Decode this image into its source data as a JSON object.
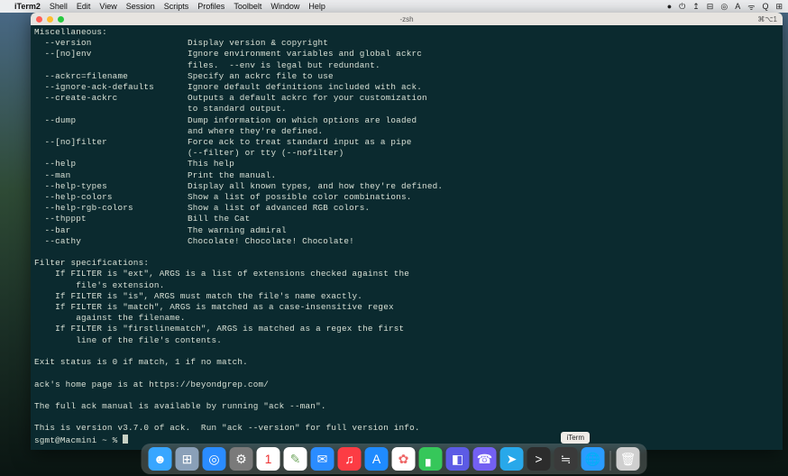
{
  "menubar": {
    "apple": "",
    "app": "iTerm2",
    "items": [
      "Shell",
      "Edit",
      "View",
      "Session",
      "Scripts",
      "Profiles",
      "Toolbelt",
      "Window",
      "Help"
    ],
    "status": [
      "●",
      "⏻",
      "↥",
      "⊟",
      "◎",
      "A",
      "ᯤ",
      "Q",
      "⊞"
    ],
    "right_text": ""
  },
  "window": {
    "title": "-zsh",
    "right_label": "⌘⌥1"
  },
  "term": {
    "section_header": "Miscellaneous:",
    "options": [
      {
        "flag": "  --version",
        "desc": "Display version & copyright"
      },
      {
        "flag": "  --[no]env",
        "desc": "Ignore environment variables and global ackrc"
      },
      {
        "flag": "",
        "desc": "files.  --env is legal but redundant."
      },
      {
        "flag": "  --ackrc=filename",
        "desc": "Specify an ackrc file to use"
      },
      {
        "flag": "  --ignore-ack-defaults",
        "desc": "Ignore default definitions included with ack."
      },
      {
        "flag": "  --create-ackrc",
        "desc": "Outputs a default ackrc for your customization"
      },
      {
        "flag": "",
        "desc": "to standard output."
      },
      {
        "flag": "  --dump",
        "desc": "Dump information on which options are loaded"
      },
      {
        "flag": "",
        "desc": "and where they're defined."
      },
      {
        "flag": "  --[no]filter",
        "desc": "Force ack to treat standard input as a pipe"
      },
      {
        "flag": "",
        "desc": "(--filter) or tty (--nofilter)"
      },
      {
        "flag": "  --help",
        "desc": "This help"
      },
      {
        "flag": "  --man",
        "desc": "Print the manual."
      },
      {
        "flag": "  --help-types",
        "desc": "Display all known types, and how they're defined."
      },
      {
        "flag": "  --help-colors",
        "desc": "Show a list of possible color combinations."
      },
      {
        "flag": "  --help-rgb-colors",
        "desc": "Show a list of advanced RGB colors."
      },
      {
        "flag": "  --thpppt",
        "desc": "Bill the Cat"
      },
      {
        "flag": "  --bar",
        "desc": "The warning admiral"
      },
      {
        "flag": "  --cathy",
        "desc": "Chocolate! Chocolate! Chocolate!"
      }
    ],
    "filterspec_header": "Filter specifications:",
    "filterspec_lines": [
      "    If FILTER is \"ext\", ARGS is a list of extensions checked against the",
      "        file's extension.",
      "    If FILTER is \"is\", ARGS must match the file's name exactly.",
      "    If FILTER is \"match\", ARGS is matched as a case-insensitive regex",
      "        against the filename.",
      "    If FILTER is \"firstlinematch\", ARGS is matched as a regex the first",
      "        line of the file's contents."
    ],
    "exit_status": "Exit status is 0 if match, 1 if no match.",
    "homepage": "ack's home page is at https://beyondgrep.com/",
    "manual_line": "The full ack manual is available by running \"ack --man\".",
    "version_line": "This is version v3.7.0 of ack.  Run \"ack --version\" for full version info.",
    "prompt": "sgmt@Macmini ~ % "
  },
  "dock": {
    "tooltip": "iTerm",
    "items": [
      {
        "name": "finder",
        "bg": "#38a6ff",
        "glyph": "☻"
      },
      {
        "name": "launchpad",
        "bg": "#8aa0b8",
        "glyph": "⊞"
      },
      {
        "name": "safari",
        "bg": "#2a8cff",
        "glyph": "◎"
      },
      {
        "name": "settings",
        "bg": "#7a7a7a",
        "glyph": "⚙"
      },
      {
        "name": "calendar",
        "bg": "#ffffff",
        "glyph": "1",
        "fg": "#e33"
      },
      {
        "name": "freeform",
        "bg": "#ffffff",
        "glyph": "✎",
        "fg": "#7a6"
      },
      {
        "name": "mail",
        "bg": "#2a8cff",
        "glyph": "✉"
      },
      {
        "name": "music",
        "bg": "#fc3c44",
        "glyph": "♫"
      },
      {
        "name": "appstore",
        "bg": "#1f8bff",
        "glyph": "A"
      },
      {
        "name": "photos",
        "bg": "#ffffff",
        "glyph": "✿",
        "fg": "#e66"
      },
      {
        "name": "facetime",
        "bg": "#36c75a",
        "glyph": "▖"
      },
      {
        "name": "shortcuts",
        "bg": "#5c5be5",
        "glyph": "◧"
      },
      {
        "name": "viber",
        "bg": "#7360f2",
        "glyph": "☎"
      },
      {
        "name": "telegram",
        "bg": "#28a8ea",
        "glyph": "➤"
      },
      {
        "name": "iterm",
        "bg": "#2c2c2c",
        "glyph": ">"
      },
      {
        "name": "activity",
        "bg": "#3a3a3a",
        "glyph": "≒"
      },
      {
        "name": "globe",
        "bg": "#2a9cff",
        "glyph": "🌐"
      },
      {
        "name": "trash",
        "bg": "#cfcfcf",
        "glyph": "🗑"
      }
    ]
  }
}
